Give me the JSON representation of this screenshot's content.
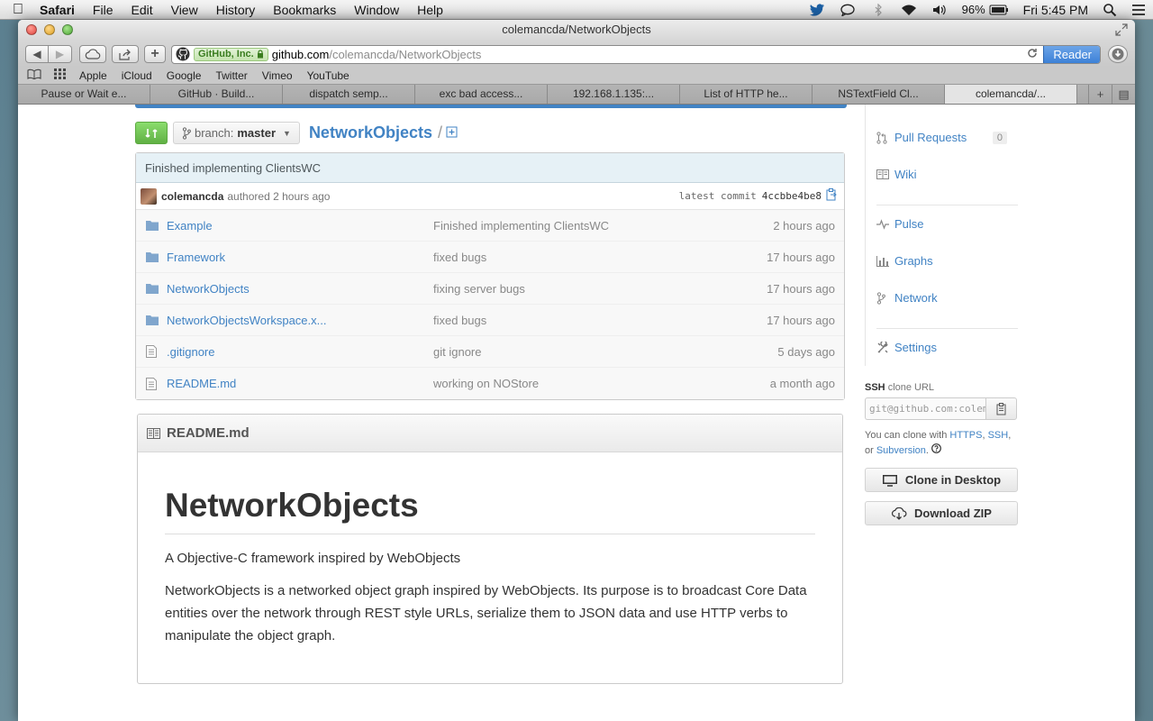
{
  "menubar": {
    "app_name": "Safari",
    "items": [
      "File",
      "Edit",
      "View",
      "History",
      "Bookmarks",
      "Window",
      "Help"
    ],
    "battery": "96%",
    "clock": "Fri 5:45 PM"
  },
  "window": {
    "title": "colemancda/NetworkObjects"
  },
  "toolbar": {
    "ev_badge": "GitHub, Inc.",
    "url_host": "github.com",
    "url_path": "/colemancda/NetworkObjects",
    "reader_label": "Reader"
  },
  "bookmarks": [
    "Apple",
    "iCloud",
    "Google",
    "Twitter",
    "Vimeo",
    "YouTube"
  ],
  "tabs": [
    "Pause or Wait e...",
    "GitHub · Build...",
    "dispatch semp...",
    "exc bad access...",
    "192.168.1.135:...",
    "List of HTTP he...",
    "NSTextField Cl...",
    "colemancda/..."
  ],
  "repo": {
    "branch_prefix": "branch:",
    "branch_name": "master",
    "name": "NetworkObjects",
    "separator": "/"
  },
  "commit": {
    "message": "Finished implementing ClientsWC",
    "author": "colemancda",
    "authored": "authored 2 hours ago",
    "latest_label": "latest commit",
    "sha": "4ccbbe4be8"
  },
  "files": [
    {
      "type": "folder",
      "name": "Example",
      "message": "Finished implementing ClientsWC",
      "age": "2 hours ago"
    },
    {
      "type": "folder",
      "name": "Framework",
      "message": "fixed bugs",
      "age": "17 hours ago"
    },
    {
      "type": "folder",
      "name": "NetworkObjects",
      "message": "fixing server bugs",
      "age": "17 hours ago"
    },
    {
      "type": "folder",
      "name": "NetworkObjectsWorkspace.x...",
      "message": "fixed bugs",
      "age": "17 hours ago"
    },
    {
      "type": "file",
      "name": ".gitignore",
      "message": "git ignore",
      "age": "5 days ago"
    },
    {
      "type": "file",
      "name": "README.md",
      "message": "working on NOStore",
      "age": "a month ago"
    }
  ],
  "readme": {
    "filename": "README.md",
    "heading": "NetworkObjects",
    "tagline": "A Objective-C framework inspired by WebObjects",
    "description": "NetworkObjects is a networked object graph inspired by WebObjects. Its purpose is to broadcast Core Data entities over the network through REST style URLs, serialize them to JSON data and use HTTP verbs to manipulate the object graph."
  },
  "sidebar": {
    "pull_requests_label": "Pull Requests",
    "pull_requests_count": "0",
    "wiki_label": "Wiki",
    "pulse_label": "Pulse",
    "graphs_label": "Graphs",
    "network_label": "Network",
    "settings_label": "Settings",
    "clone_protocol": "SSH",
    "clone_suffix": "clone URL",
    "clone_url": "git@github.com:colemancda/NetworkObjects.git",
    "clone_help_prefix": "You can clone with",
    "clone_https": "HTTPS",
    "clone_ssh": "SSH",
    "clone_or": "or",
    "clone_subversion": "Subversion",
    "clone_desktop_label": "Clone in Desktop",
    "download_zip_label": "Download ZIP"
  },
  "colors": {
    "link": "#4183c4",
    "compare_button": "#60b044",
    "commit_bar": "#e6f1f6",
    "reader_button": "#3a7fd6"
  }
}
